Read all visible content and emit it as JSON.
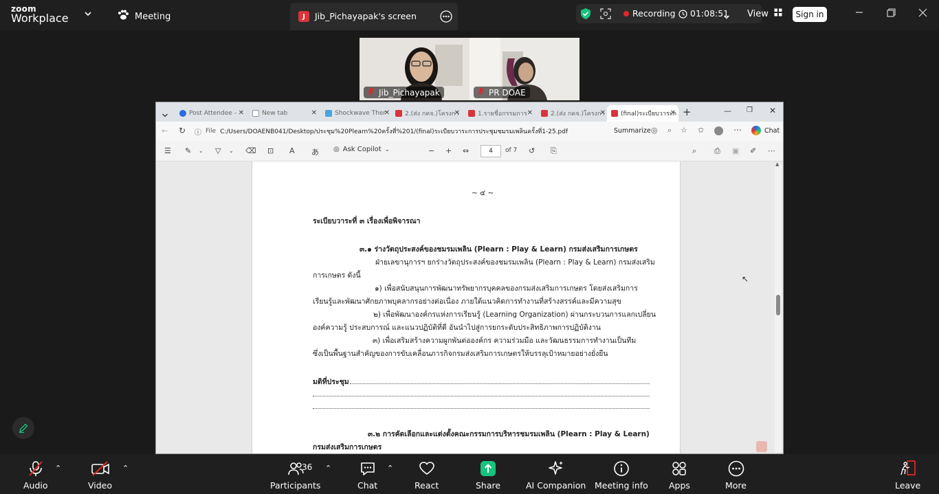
{
  "zoom": {
    "logo_line1": "zoom",
    "logo_line2": "Workplace",
    "meeting_label": "Meeting",
    "screen_share_label": "Jib_Pichayapak's screen",
    "screen_badge": "J",
    "recording_label": "Recording",
    "timer": "01:08:51",
    "view_label": "View",
    "signin_label": "Sign in"
  },
  "participants": [
    {
      "name": "Jib_Pichayapak"
    },
    {
      "name": "PR DOAE"
    }
  ],
  "browser": {
    "tabs": [
      {
        "label": "Post Attendee -",
        "fav": "#2d6cdf"
      },
      {
        "label": "New tab",
        "fav": "#999999"
      },
      {
        "label": "Shockwave Ther",
        "fav": "#4aa3df"
      },
      {
        "label": "2.(ส่ง กคจ.)โครงกา",
        "fav": "#d9343a"
      },
      {
        "label": "1.รายชื่อกรรมการ",
        "fav": "#d9343a"
      },
      {
        "label": "2.(ส่ง กคจ.)โครงกา",
        "fav": "#d9343a"
      },
      {
        "label": "(final)ระเบียบวาระก",
        "fav": "#d9343a"
      }
    ],
    "address_scheme": "File",
    "address": "C:/Users/DOAENB041/Desktop/ประชุม%20Plearn%20ครั้งที่%201/(final)ระเบียบวาระการประชุมชมรมเพลินครั้งที่1-25.pdf",
    "summarize_label": "Summarize",
    "chat_label": "Chat",
    "ask_copilot_label": "Ask Copilot",
    "page_number": "4",
    "page_total": "of 7"
  },
  "document": {
    "page_header": "~ ๔ ~",
    "agenda_heading": "ระเบียบวาระที่ ๓ เรื่องเพื่อพิจารณา",
    "item_3_1_title": "๓.๑ ร่างวัตถุประสงค์ของชมรมเพลิน (Plearn : Play & Learn) กรมส่งเสริมการเกษตร",
    "item_3_1_intro_1": "ฝ่ายเลขานุการฯ ยกร่างวัตถุประสงค์ของชมรมเพลิน (Plearn : Play & Learn) กรมส่งเสริม",
    "item_3_1_intro_2": "การเกษตร ดังนี้",
    "obj_1_a": "๑) เพื่อสนับสนุนการพัฒนาทรัพยากรบุคคลของกรมส่งเสริมการเกษตร โดยส่งเสริมการ",
    "obj_1_b": "เรียนรู้และพัฒนาศักยภาพบุคลากรอย่างต่อเนื่อง ภายใต้แนวคิดการทำงานที่สร้างสรรค์และมีความสุข",
    "obj_2_a": "๒) เพื่อพัฒนาองค์กรแห่งการเรียนรู้ (Learning Organization) ผ่านกระบวนการแลกเปลี่ยน",
    "obj_2_b": "องค์ความรู้ ประสบการณ์ และแนวปฏิบัติที่ดี อันนำไปสู่การยกระดับประสิทธิภาพการปฏิบัติงาน",
    "obj_3_a": "๓) เพื่อเสริมสร้างความผูกพันต่อองค์กร ความร่วมมือ และวัฒนธรรมการทำงานเป็นทีม",
    "obj_3_b": "ซึ่งเป็นพื้นฐานสำคัญของการขับเคลื่อนภารกิจกรมส่งเสริมการเกษตรให้บรรลุเป้าหมายอย่างยั่งยืน",
    "resolution_label": "มติที่ประชุม",
    "item_3_2_title": "๓.๒ การคัดเลือกและแต่งตั้งคณะกรรมการบริหารชมรมเพลิน (Plearn : Play & Learn)",
    "item_3_2_title_2": "กรมส่งเสริมการเกษตร"
  },
  "toolbar": {
    "audio": "Audio",
    "video": "Video",
    "participants": "Participants",
    "participants_count": "36",
    "chat": "Chat",
    "react": "React",
    "share": "Share",
    "ai_companion": "AI Companion",
    "meeting_info": "Meeting info",
    "apps": "Apps",
    "more": "More",
    "leave": "Leave"
  },
  "colors": {
    "share_green": "#19c37d",
    "recording_red": "#e02828",
    "shield_green": "#19c37d",
    "leave_red": "#e02828"
  }
}
